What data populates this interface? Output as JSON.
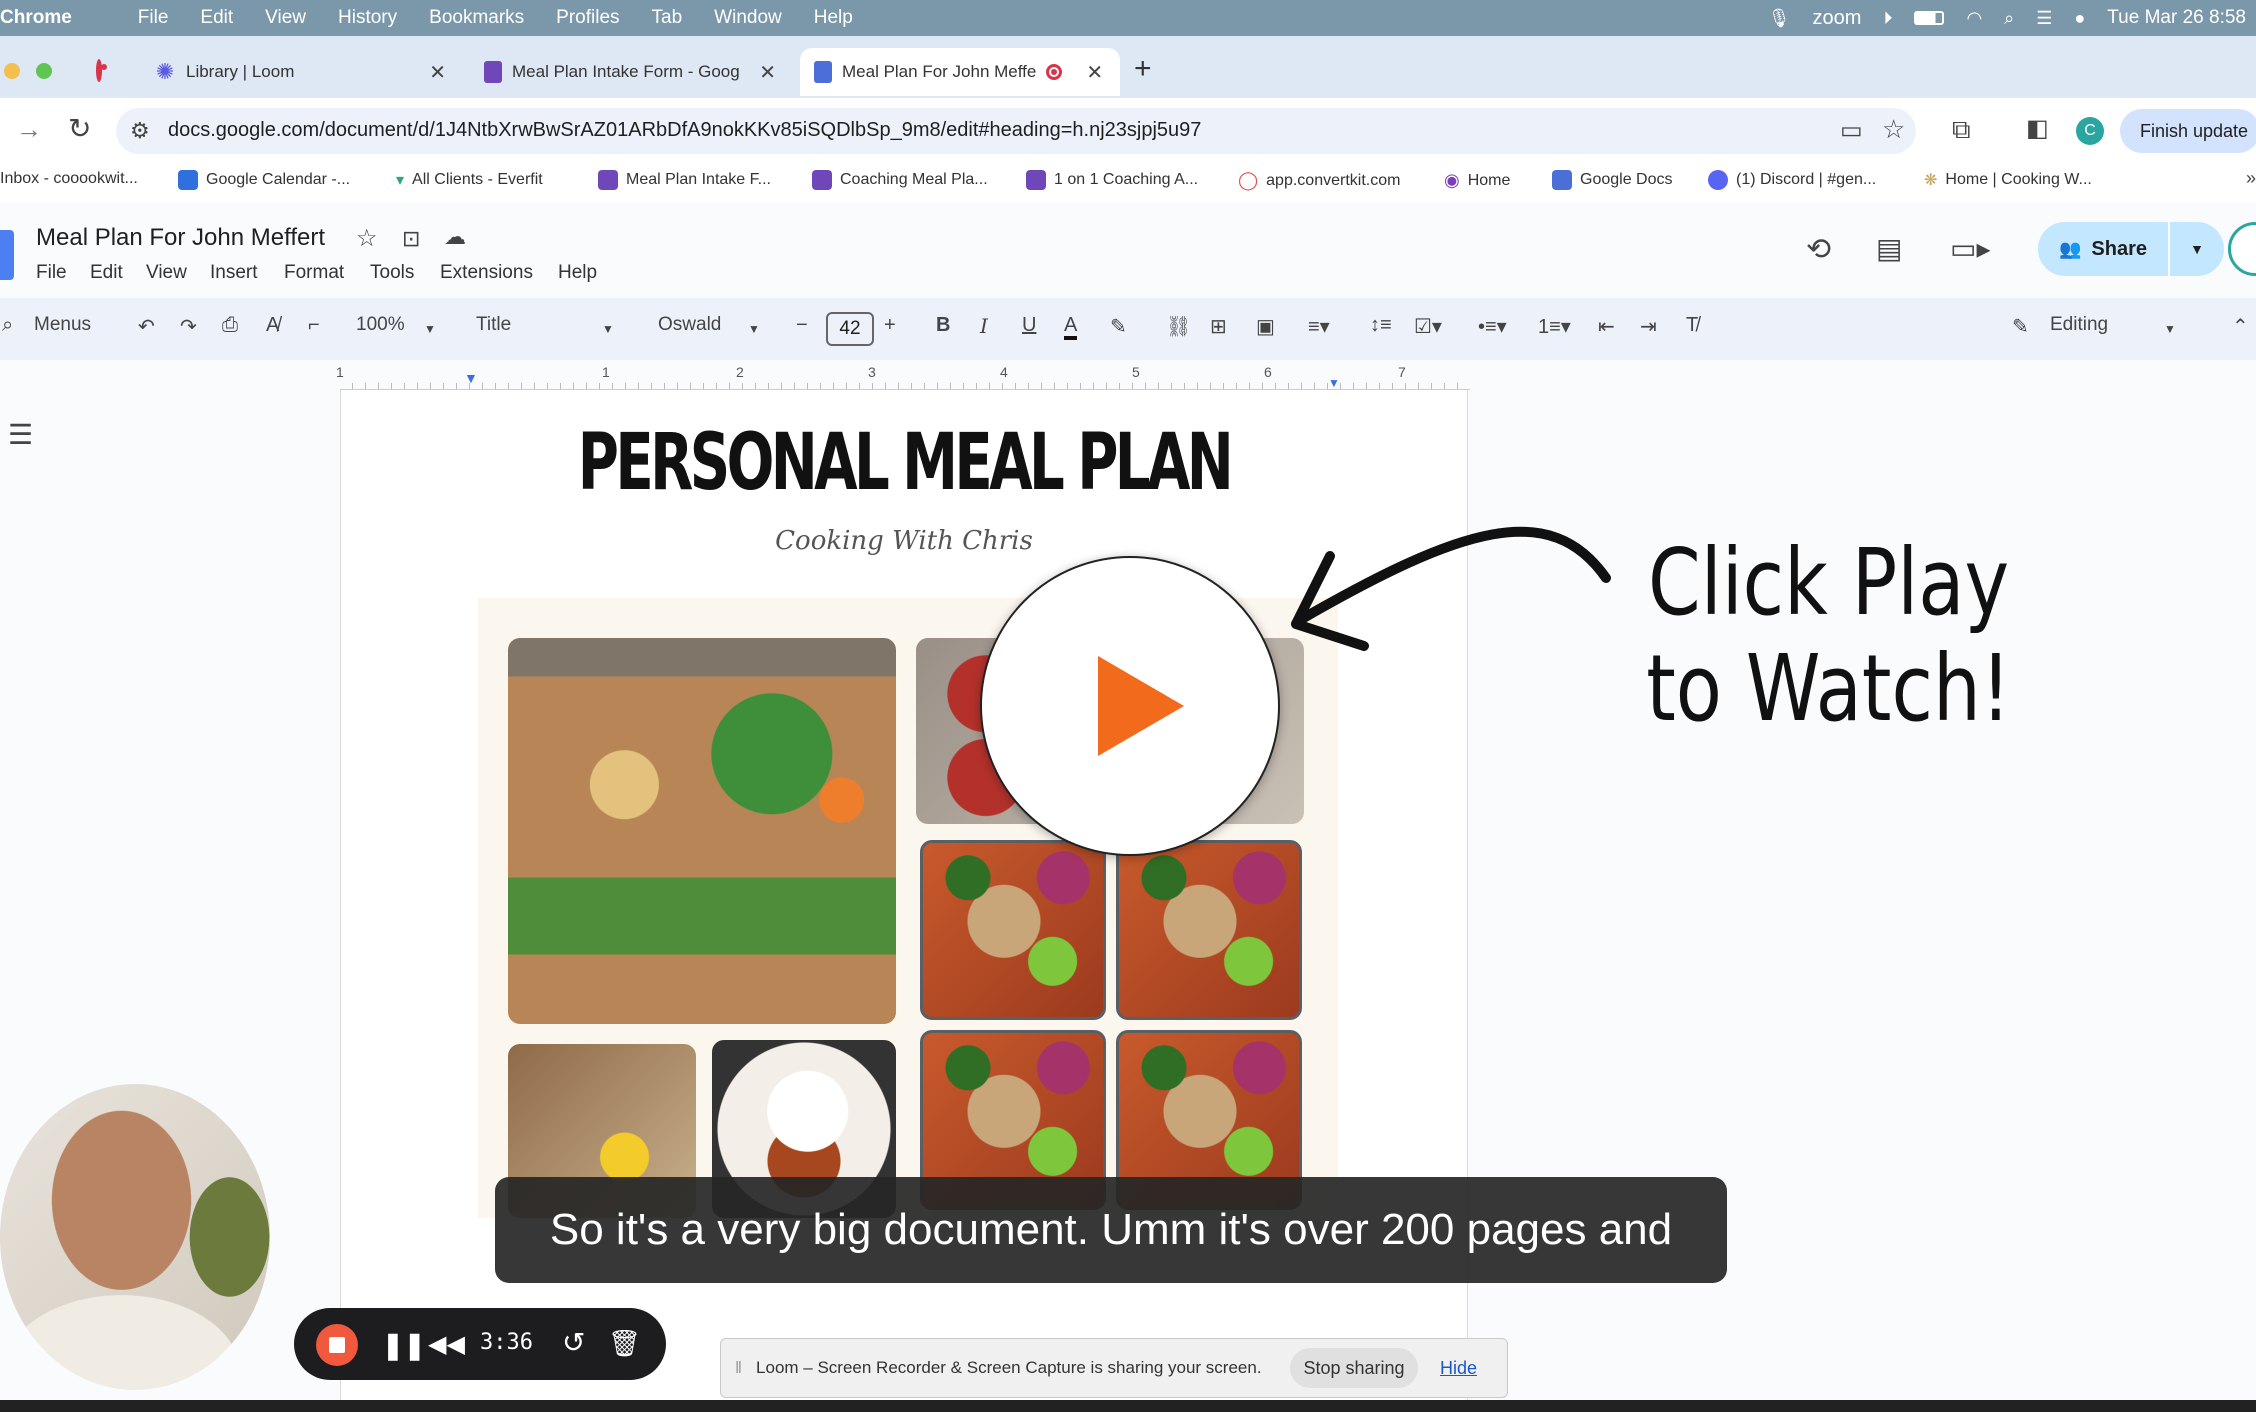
{
  "menubar": {
    "app": "Chrome",
    "items": [
      "File",
      "Edit",
      "View",
      "History",
      "Bookmarks",
      "Profiles",
      "Tab",
      "Window",
      "Help"
    ],
    "zoom_label": "zoom",
    "clock": "Tue Mar 26  8:58"
  },
  "tabs": [
    {
      "title": "Library | Loom"
    },
    {
      "title": "Meal Plan Intake Form - Goog"
    },
    {
      "title": "Meal Plan For John Meffe"
    }
  ],
  "new_tab": "+",
  "address_bar": {
    "url": "docs.google.com/document/d/1J4NtbXrwBwSrAZ01ARbDfA9nokKKv85iSQDlbSp_9m8/edit#heading=h.nj23sjpj5u97",
    "profile_initial": "C",
    "finish_update": "Finish update"
  },
  "bookmarks": [
    "Inbox - cooookwit...",
    "Google Calendar -...",
    "All Clients - Everfit",
    "Meal Plan Intake F...",
    "Coaching Meal Pla...",
    "1 on 1 Coaching A...",
    "app.convertkit.com",
    "Home",
    "Google Docs",
    "(1) Discord | #gen...",
    "Home | Cooking W..."
  ],
  "docs": {
    "title": "Meal Plan For John Meffert",
    "menus": [
      "File",
      "Edit",
      "View",
      "Insert",
      "Format",
      "Tools",
      "Extensions",
      "Help"
    ],
    "share_label": "Share",
    "toolbar": {
      "search_menus": "Menus",
      "zoom": "100%",
      "style": "Title",
      "font": "Oswald",
      "font_size": "42",
      "mode": "Editing"
    },
    "ruler_marks": [
      "1",
      "1",
      "2",
      "3",
      "4",
      "5",
      "6",
      "7"
    ]
  },
  "document": {
    "heading": "PERSONAL MEAL PLAN",
    "subtitle": "Cooking With Chris"
  },
  "video": {
    "cta_line1": "Click Play",
    "cta_line2": "to Watch!",
    "caption": "So it's a very big document. Umm it's over 200 pages and"
  },
  "recorder": {
    "time": "3:36"
  },
  "share_notice": {
    "message": "Loom – Screen Recorder & Screen Capture is sharing your screen.",
    "stop": "Stop sharing",
    "hide": "Hide"
  },
  "colors": {
    "menubar": "#7b98ab",
    "share_button": "#c2e7ff",
    "play_triangle": "#f26a1b",
    "record_stop": "#f0593c"
  }
}
